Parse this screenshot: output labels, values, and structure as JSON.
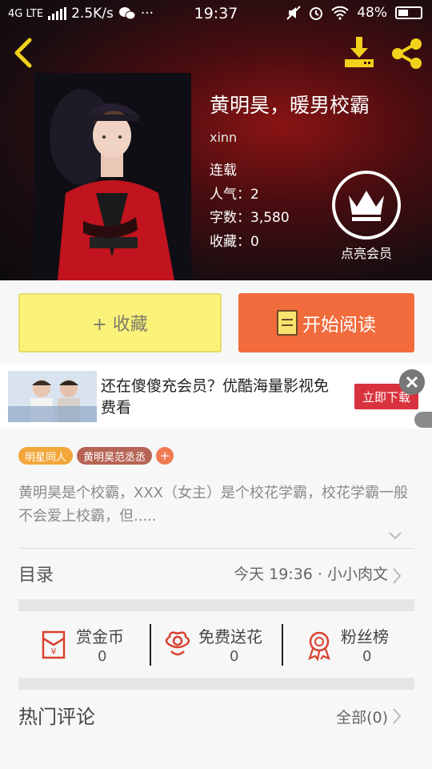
{
  "status_bar": {
    "network": "4G LTE",
    "speed": "2.5K/s",
    "time": "19:37",
    "battery": "48%"
  },
  "header": {
    "back_icon": "chevron-left-icon",
    "download_icon": "download-icon",
    "share_icon": "share-icon"
  },
  "book": {
    "title": "黄明昊，暖男校霸",
    "author": "xinn",
    "status": "连载",
    "popularity": "人气：2",
    "word_count": "字数：3,580",
    "favorites": "收藏：0",
    "vip_label": "点亮会员"
  },
  "actions": {
    "favorite_label": "+ 收藏",
    "read_label": "开始阅读"
  },
  "ad": {
    "text": "还在傻傻充会员？优酷海量影视免费看",
    "button": "立即下载"
  },
  "tags": [
    "明星同人",
    "黄明昊范丞丞"
  ],
  "tag_add": "+",
  "description": "黄明昊是个校霸，XXX（女主）是个校花学霸，校花学霸一般不会爱上校霸，但.....",
  "catalog": {
    "title": "目录",
    "latest": "今天 19:36 · 小小肉文"
  },
  "stats": [
    {
      "label": "赏金币",
      "value": "0",
      "icon": "red-envelope-icon"
    },
    {
      "label": "免费送花",
      "value": "0",
      "icon": "flower-icon"
    },
    {
      "label": "粉丝榜",
      "value": "0",
      "icon": "medal-icon"
    }
  ],
  "comments": {
    "title": "热门评论",
    "all": "全部(0)"
  },
  "colors": {
    "favorite_bg": "#fbf27a",
    "read_bg": "#f16b3c",
    "accent_red": "#d7323d",
    "header_icon": "#f2d11c"
  }
}
